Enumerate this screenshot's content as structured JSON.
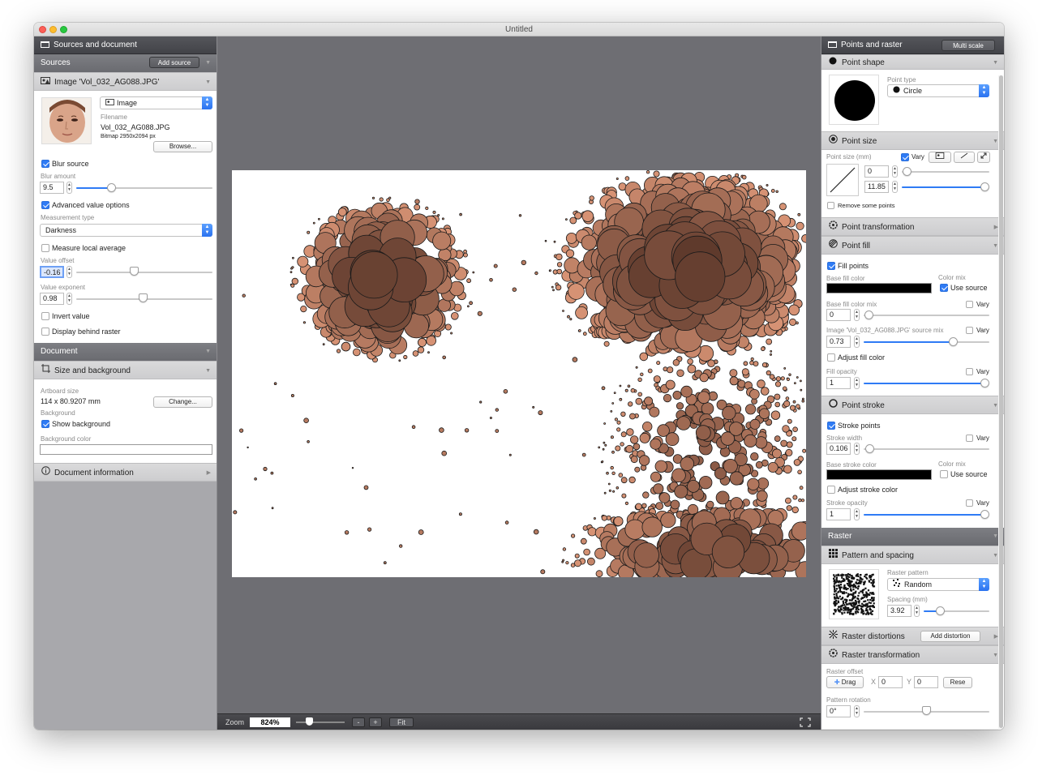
{
  "window": {
    "title": "Untitled"
  },
  "left": {
    "header": "Sources and document",
    "sources_section": "Sources",
    "add_source_label": "Add source",
    "image_source_title": "Image 'Vol_032_AG088.JPG'",
    "image_type": "Image",
    "filename_label": "Filename",
    "filename": "Vol_032_AG088.JPG",
    "bitmap_info": "Bitmap 2950x2094 px",
    "browse_label": "Browse...",
    "blur_source_label": "Blur source",
    "blur_amount_label": "Blur amount",
    "blur_amount_value": "9.5",
    "blur_amount_level": 0.27,
    "advanced_label": "Advanced value options",
    "measurement_type_label": "Measurement type",
    "measurement_type_value": "Darkness",
    "measure_local_label": "Measure local average",
    "value_offset_label": "Value offset",
    "value_offset_value": "-0.16",
    "value_exponent_label": "Value exponent",
    "value_exponent_value": "0.98",
    "invert_value_label": "Invert value",
    "display_behind_label": "Display behind raster",
    "document_section": "Document",
    "size_background_title": "Size and background",
    "artboard_size_label": "Artboard size",
    "artboard_size_value": "114 x 80.9207 mm",
    "change_label": "Change...",
    "background_label": "Background",
    "show_background_label": "Show background",
    "background_color_label": "Background color",
    "document_information_title": "Document information"
  },
  "zoom": {
    "label": "Zoom",
    "value": "824%",
    "minus": "-",
    "plus": "+",
    "fit": "Fit"
  },
  "right": {
    "header": "Points and raster",
    "multi_scale_label": "Multi scale",
    "point_shape_title": "Point shape",
    "point_type_label": "Point type",
    "point_type_value": "Circle",
    "point_size_title": "Point size",
    "point_size_label": "Point size (mm)",
    "vary_label": "Vary",
    "point_size_min": "0",
    "point_size_max": "11.85",
    "remove_some_points_label": "Remove some points",
    "point_transformation_title": "Point transformation",
    "point_fill_title": "Point fill",
    "fill_points_label": "Fill points",
    "base_fill_color_label": "Base fill color",
    "color_mix_label": "Color mix",
    "use_source_label": "Use source",
    "base_fill_color_mix_label": "Base fill color mix",
    "base_fill_color_mix_value": "0",
    "image_source_mix_label": "Image 'Vol_032_AG088.JPG' source mix",
    "image_source_mix_value": "0.73",
    "adjust_fill_color_label": "Adjust fill color",
    "fill_opacity_label": "Fill opacity",
    "fill_opacity_value": "1",
    "point_stroke_title": "Point stroke",
    "stroke_points_label": "Stroke points",
    "stroke_width_label": "Stroke width",
    "stroke_width_value": "0.106",
    "base_stroke_color_label": "Base stroke color",
    "stroke_color_mix_label": "Color mix",
    "stroke_use_source_label": "Use source",
    "adjust_stroke_color_label": "Adjust stroke color",
    "stroke_opacity_label": "Stroke opacity",
    "stroke_opacity_value": "1",
    "raster_section": "Raster",
    "pattern_spacing_title": "Pattern and spacing",
    "raster_pattern_label": "Raster pattern",
    "raster_pattern_value": "Random",
    "spacing_label": "Spacing (mm)",
    "spacing_value": "3.92",
    "raster_distortions_title": "Raster distortions",
    "add_distortion_label": "Add distortion",
    "raster_transformation_title": "Raster transformation",
    "raster_offset_label": "Raster offset",
    "drag_label": "Drag",
    "x_label": "X",
    "x_value": "0",
    "y_label": "Y",
    "y_value": "0",
    "reset_label": "Rese",
    "pattern_rotation_label": "Pattern rotation",
    "pattern_rotation_value": "0°"
  },
  "colors": {
    "accent": "#2f7bf5",
    "canvas_bg": "#6e6e73",
    "panel_header": "#4a4b50",
    "point_dark": "#3b1f17",
    "point_light": "#d18a6c"
  },
  "icons": {
    "document": "document-icon",
    "image": "image-source-icon",
    "circle": "circle-shape-icon",
    "fill": "fill-icon",
    "stroke": "stroke-icon",
    "raster": "grid-icon",
    "distortion": "distortion-icon",
    "transform": "transform-icon",
    "fullscreen": "fullscreen-icon"
  }
}
